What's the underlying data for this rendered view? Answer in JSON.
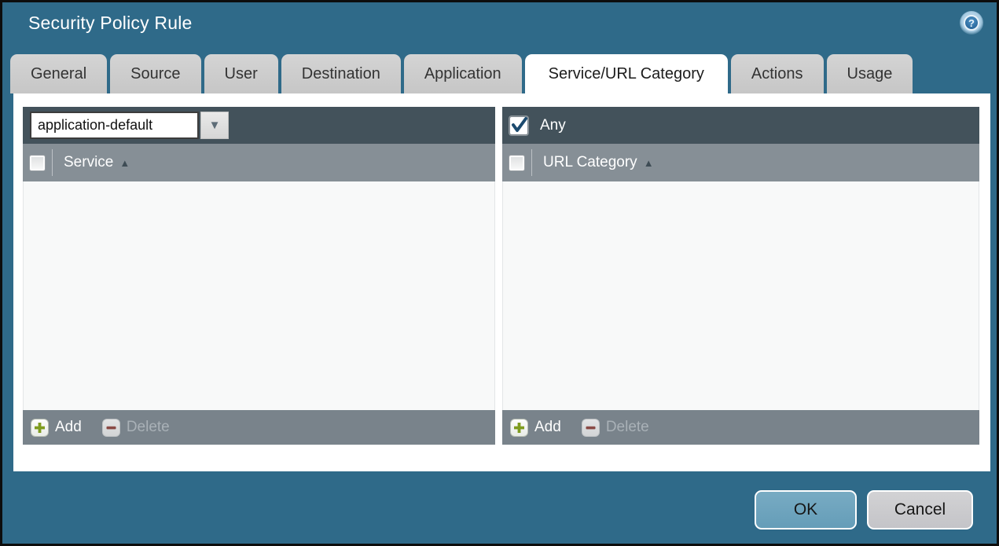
{
  "dialog": {
    "title": "Security Policy Rule"
  },
  "icons": {
    "help_glyph": "?",
    "dropdown_glyph": "▼",
    "sort_asc_glyph": "▲"
  },
  "tabs": [
    {
      "label": "General",
      "active": false
    },
    {
      "label": "Source",
      "active": false
    },
    {
      "label": "User",
      "active": false
    },
    {
      "label": "Destination",
      "active": false
    },
    {
      "label": "Application",
      "active": false
    },
    {
      "label": "Service/URL Category",
      "active": true
    },
    {
      "label": "Actions",
      "active": false
    },
    {
      "label": "Usage",
      "active": false
    }
  ],
  "service_panel": {
    "dropdown_value": "application-default",
    "header_checkbox_checked": false,
    "column_header": "Service",
    "rows": [],
    "add_label": "Add",
    "delete_label": "Delete",
    "delete_enabled": false
  },
  "url_category_panel": {
    "any_label": "Any",
    "any_checked": true,
    "header_checkbox_checked": false,
    "column_header": "URL Category",
    "rows": [],
    "add_label": "Add",
    "delete_label": "Delete",
    "delete_enabled": false
  },
  "footer": {
    "ok_label": "OK",
    "cancel_label": "Cancel"
  },
  "colors": {
    "background": "#2f6a89",
    "panel_toolbar": "#43525b",
    "column_header": "#868f96",
    "footer_bar": "#79838b",
    "tab_inactive": "#cbcbcb",
    "tab_active": "#ffffff",
    "ok_button": "#6da3bd",
    "cancel_button": "#cbcbcd",
    "add_plus": "#7f9c1f",
    "delete_minus": "#8a4a45",
    "check_mark": "#1c4a6e"
  }
}
